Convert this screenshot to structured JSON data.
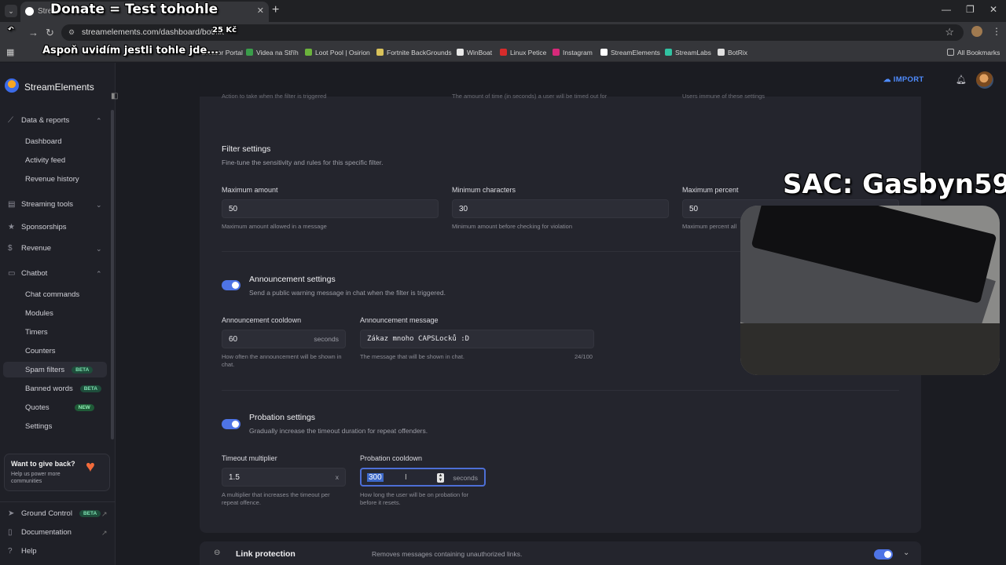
{
  "browser": {
    "tab_title": "StreamElements",
    "url": "streamelements.com/dashboard/bot/filt",
    "bookmarks": [
      "Creator Portal",
      "Videa na Stříh",
      "Loot Pool | Osirion",
      "Fortnite BackGrounds",
      "WinBoat",
      "Linux Petice",
      "Instagram",
      "StreamElements",
      "StreamLabs",
      "BotRix"
    ],
    "all_bookmarks": "All Bookmarks"
  },
  "overlay": {
    "donate": "Donate = Test tohohle",
    "amount": "25 Kč",
    "message": "Aspoň uvidím jestli tohle jde...",
    "sac": "SAC: Gasbyn59"
  },
  "app": {
    "brand": "StreamElements",
    "import_label": "IMPORT"
  },
  "sidebar": {
    "groups": {
      "data_reports": "Data & reports",
      "streaming_tools": "Streaming tools",
      "sponsorships": "Sponsorships",
      "revenue": "Revenue",
      "chatbot": "Chatbot"
    },
    "items": {
      "dashboard": "Dashboard",
      "activity_feed": "Activity feed",
      "revenue_history": "Revenue history",
      "chat_commands": "Chat commands",
      "modules": "Modules",
      "timers": "Timers",
      "counters": "Counters",
      "spam_filters": "Spam filters",
      "banned_words": "Banned words",
      "quotes": "Quotes",
      "settings": "Settings"
    },
    "badges": {
      "beta": "BETA",
      "new": "NEW"
    },
    "give_back": {
      "title": "Want to give back?",
      "subtitle": "Help us power more communities"
    },
    "footer": {
      "ground_control": "Ground Control",
      "documentation": "Documentation",
      "help": "Help"
    }
  },
  "filter_settings": {
    "top_hints": [
      "Action to take when the filter is triggered",
      "The amount of time (in seconds) a user will be timed out for",
      "Users immune of these settings"
    ],
    "title": "Filter settings",
    "subtitle": "Fine-tune the sensitivity and rules for this specific filter.",
    "max_amount": {
      "label": "Maximum amount",
      "value": "50",
      "help": "Maximum amount allowed in a message"
    },
    "min_chars": {
      "label": "Minimum characters",
      "value": "30",
      "help": "Minimum amount before checking for violation"
    },
    "max_percent": {
      "label": "Maximum percent",
      "value": "50",
      "help": "Maximum percent all"
    }
  },
  "announcement": {
    "enabled": true,
    "title": "Announcement settings",
    "subtitle": "Send a public warning message in chat when the filter is triggered.",
    "cooldown": {
      "label": "Announcement cooldown",
      "value": "60",
      "suffix": "seconds",
      "help": "How often the announcement will be shown in chat."
    },
    "message": {
      "label": "Announcement message",
      "value": "Zákaz mnoho CAPSLocků :D",
      "help": "The message that will be shown in chat.",
      "counter": "24/100"
    }
  },
  "probation": {
    "enabled": true,
    "title": "Probation settings",
    "subtitle": "Gradually increase the timeout duration for repeat offenders.",
    "multiplier": {
      "label": "Timeout multiplier",
      "value": "1.5",
      "suffix": "x",
      "help": "A multiplier that increases the timeout per repeat offence."
    },
    "cooldown": {
      "label": "Probation cooldown",
      "value": "300",
      "suffix": "seconds",
      "help": "How long the user will be on probation for before it resets."
    }
  },
  "link_protection": {
    "enabled": true,
    "title": "Link protection",
    "description": "Removes messages containing unauthorized links."
  },
  "colors": {
    "accent": "#4e74e6",
    "import": "#4f8cff",
    "heart": "#f36b3b"
  }
}
